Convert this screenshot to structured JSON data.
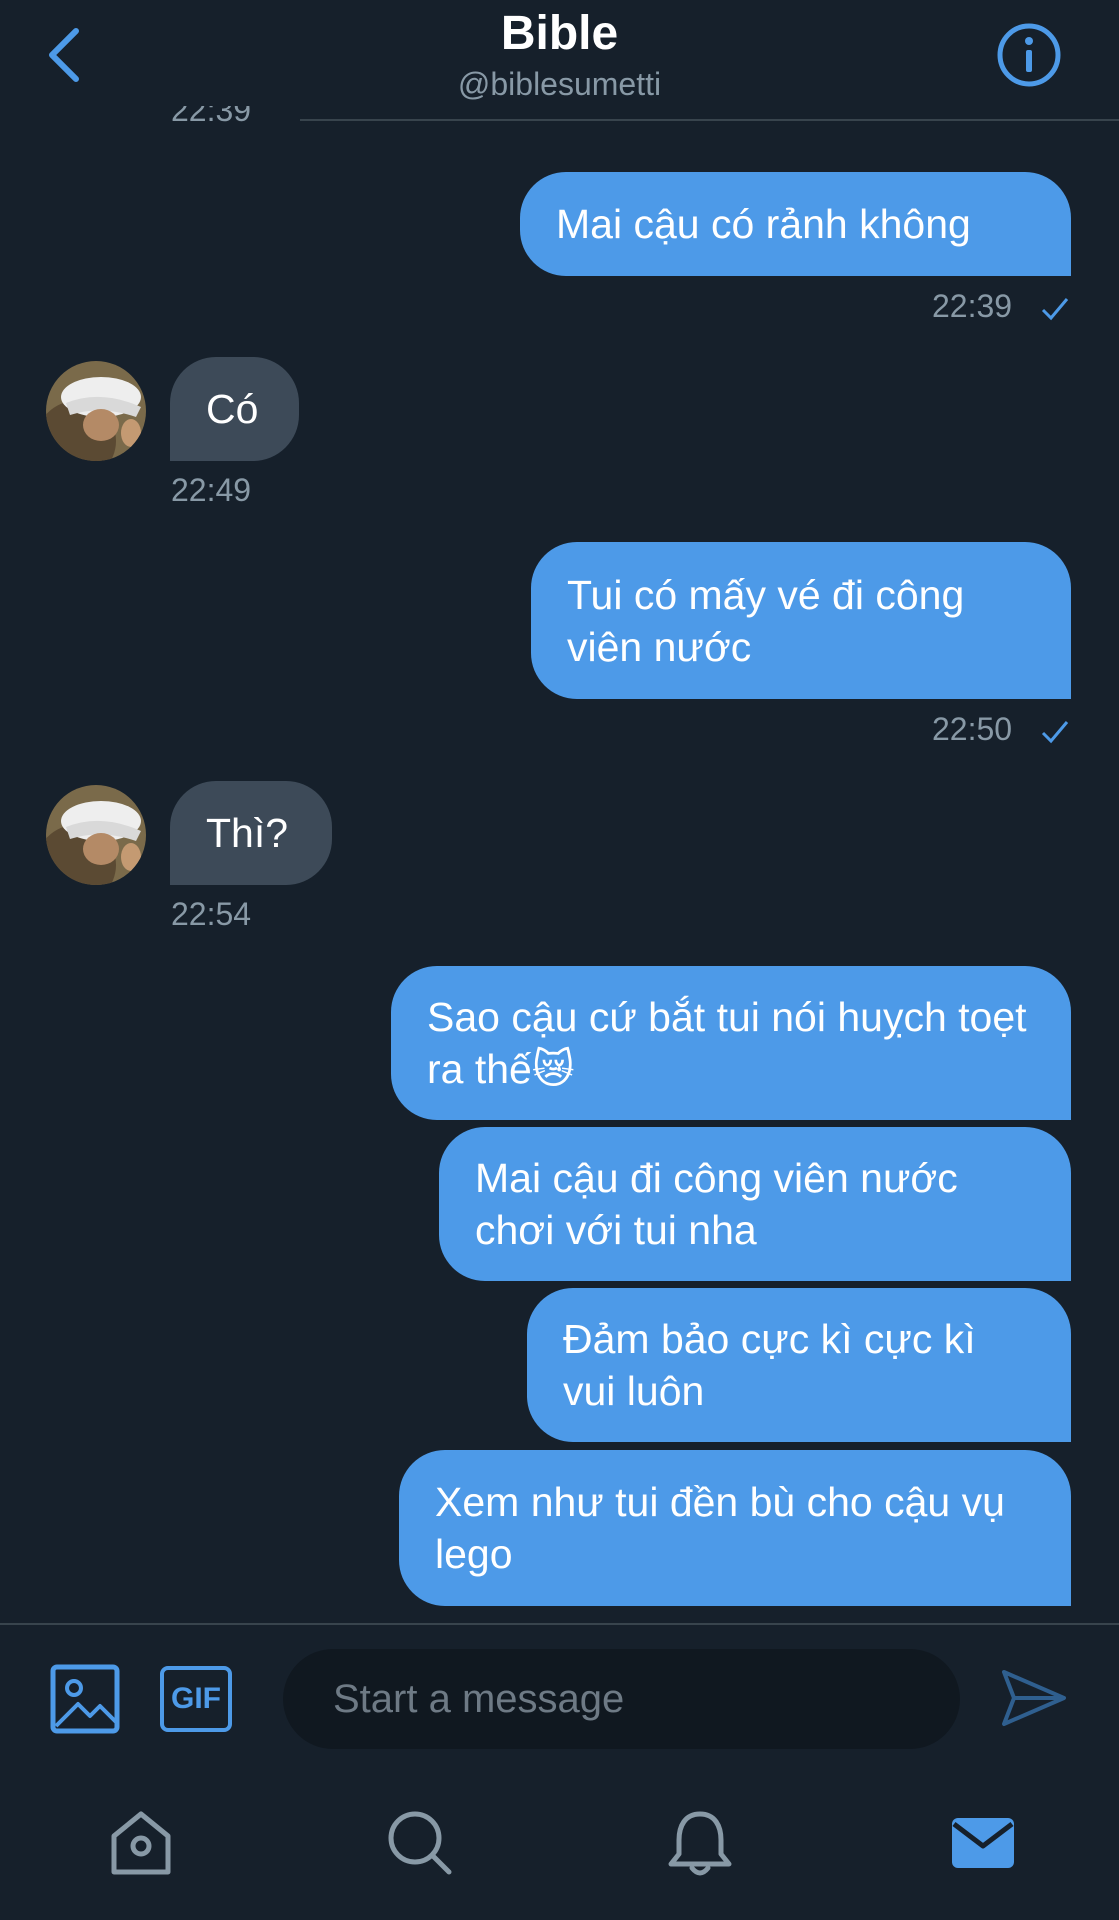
{
  "header": {
    "title": "Bible",
    "handle": "@biblesumetti",
    "back_icon": "chevron-left-icon",
    "info_icon": "info-icon"
  },
  "partial_timestamp": "22:39",
  "messages": [
    {
      "dir": "sent",
      "text": "Mai cậu có rảnh không",
      "time": "22:39",
      "status": "check-icon"
    },
    {
      "dir": "received",
      "text": "Có",
      "time": "22:49"
    },
    {
      "dir": "sent",
      "text": "Tui có mấy vé đi công viên nước",
      "time": "22:50",
      "status": "check-icon"
    },
    {
      "dir": "received",
      "text": "Thì?",
      "time": "22:54"
    },
    {
      "dir": "sent",
      "text": "Sao cậu cứ bắt tui nói huỵch toẹt ra thế😿"
    },
    {
      "dir": "sent",
      "text": "Mai cậu đi công viên nước chơi với tui nha"
    },
    {
      "dir": "sent",
      "text": "Đảm bảo cực kì cực kì vui luôn"
    },
    {
      "dir": "sent",
      "text": "Xem như tui đền bù cho cậu vụ lego"
    }
  ],
  "composer": {
    "placeholder": "Start a message",
    "gif_label": "GIF",
    "image_icon": "image-icon",
    "send_icon": "send-icon"
  },
  "nav": [
    "home-icon",
    "search-icon",
    "bell-icon",
    "mail-icon"
  ],
  "colors": {
    "background": "#16202b",
    "accent": "#4d9ae8",
    "received_bubble": "#3d4a58",
    "secondary_text": "#8899a6"
  }
}
